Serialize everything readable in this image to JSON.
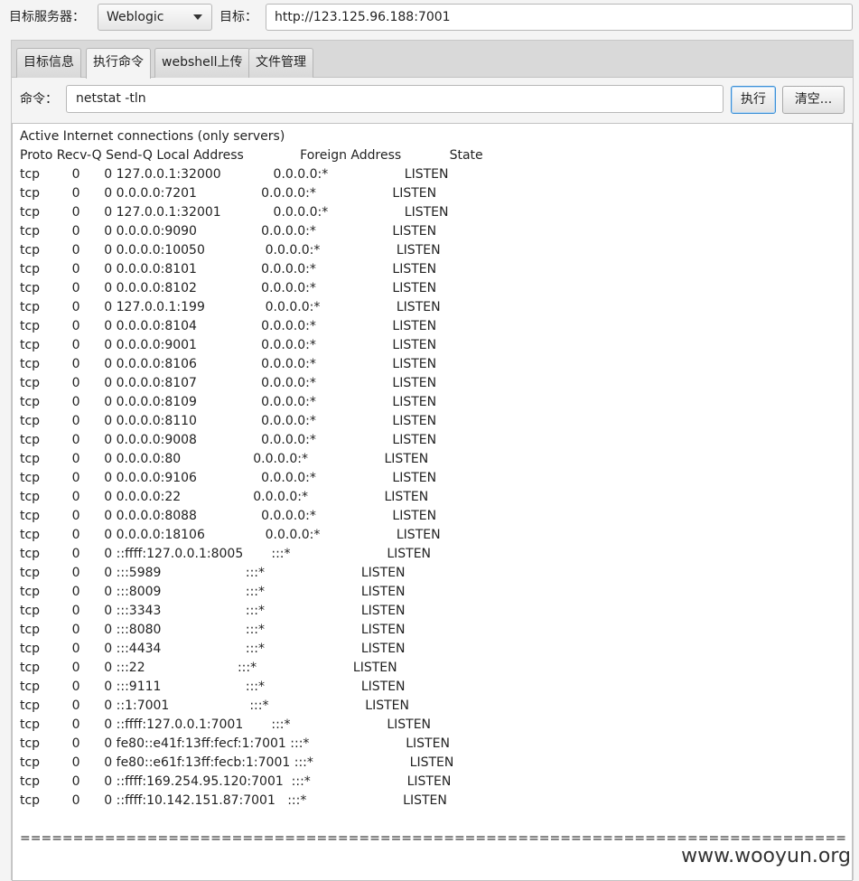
{
  "top": {
    "server_label": "目标服务器：",
    "server_selected": "Weblogic",
    "target_label": "目标：",
    "target_url": "http://123.125.96.188:7001"
  },
  "tabs": [
    {
      "label": "目标信息",
      "active": false
    },
    {
      "label": "执行命令",
      "active": true
    },
    {
      "label": "webshell上传",
      "active": false
    },
    {
      "label": "文件管理",
      "active": false
    }
  ],
  "command": {
    "label": "命令：",
    "value": "netstat -tln",
    "execute_label": "执行",
    "clear_label": "清空..."
  },
  "output": {
    "lines": [
      "Active Internet connections (only servers)",
      "Proto Recv-Q Send-Q Local Address              Foreign Address            State",
      "tcp        0      0 127.0.0.1:32000             0.0.0.0:*                   LISTEN",
      "tcp        0      0 0.0.0.0:7201                0.0.0.0:*                   LISTEN",
      "tcp        0      0 127.0.0.1:32001             0.0.0.0:*                   LISTEN",
      "tcp        0      0 0.0.0.0:9090                0.0.0.0:*                   LISTEN",
      "tcp        0      0 0.0.0.0:10050               0.0.0.0:*                   LISTEN",
      "tcp        0      0 0.0.0.0:8101                0.0.0.0:*                   LISTEN",
      "tcp        0      0 0.0.0.0:8102                0.0.0.0:*                   LISTEN",
      "tcp        0      0 127.0.0.1:199               0.0.0.0:*                   LISTEN",
      "tcp        0      0 0.0.0.0:8104                0.0.0.0:*                   LISTEN",
      "tcp        0      0 0.0.0.0:9001                0.0.0.0:*                   LISTEN",
      "tcp        0      0 0.0.0.0:8106                0.0.0.0:*                   LISTEN",
      "tcp        0      0 0.0.0.0:8107                0.0.0.0:*                   LISTEN",
      "tcp        0      0 0.0.0.0:8109                0.0.0.0:*                   LISTEN",
      "tcp        0      0 0.0.0.0:8110                0.0.0.0:*                   LISTEN",
      "tcp        0      0 0.0.0.0:9008                0.0.0.0:*                   LISTEN",
      "tcp        0      0 0.0.0.0:80                  0.0.0.0:*                   LISTEN",
      "tcp        0      0 0.0.0.0:9106                0.0.0.0:*                   LISTEN",
      "tcp        0      0 0.0.0.0:22                  0.0.0.0:*                   LISTEN",
      "tcp        0      0 0.0.0.0:8088                0.0.0.0:*                   LISTEN",
      "tcp        0      0 0.0.0.0:18106               0.0.0.0:*                   LISTEN",
      "tcp        0      0 ::ffff:127.0.0.1:8005       :::*                        LISTEN",
      "tcp        0      0 :::5989                     :::*                        LISTEN",
      "tcp        0      0 :::8009                     :::*                        LISTEN",
      "tcp        0      0 :::3343                     :::*                        LISTEN",
      "tcp        0      0 :::8080                     :::*                        LISTEN",
      "tcp        0      0 :::4434                     :::*                        LISTEN",
      "tcp        0      0 :::22                       :::*                        LISTEN",
      "tcp        0      0 :::9111                     :::*                        LISTEN",
      "tcp        0      0 ::1:7001                    :::*                        LISTEN",
      "tcp        0      0 ::ffff:127.0.0.1:7001       :::*                        LISTEN",
      "tcp        0      0 fe80::e41f:13ff:fecf:1:7001 :::*                        LISTEN",
      "tcp        0      0 fe80::e61f:13ff:fecb:1:7001 :::*                        LISTEN",
      "tcp        0      0 ::ffff:169.254.95.120:7001  :::*                        LISTEN",
      "tcp        0      0 ::ffff:10.142.151.87:7001   :::*                        LISTEN",
      "",
      "=============================================================================="
    ]
  },
  "watermark": "www.wooyun.org"
}
